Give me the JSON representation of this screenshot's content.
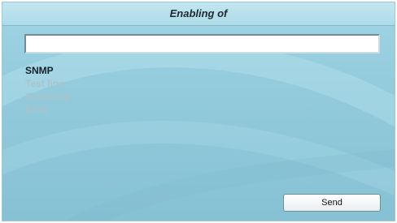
{
  "dialog": {
    "title": "Enabling of"
  },
  "text_field": {
    "value": ""
  },
  "options": [
    {
      "label": "SNMP",
      "state": "active"
    },
    {
      "label": "Test line",
      "state": "disabled"
    },
    {
      "label": "Subtitling",
      "state": "disabled"
    },
    {
      "label": "BISS",
      "state": "disabled"
    }
  ],
  "actions": {
    "send_label": "Send"
  },
  "colors": {
    "background": "#92cadb",
    "active_text": "#14232a",
    "disabled_text": "#a9c4cc"
  }
}
